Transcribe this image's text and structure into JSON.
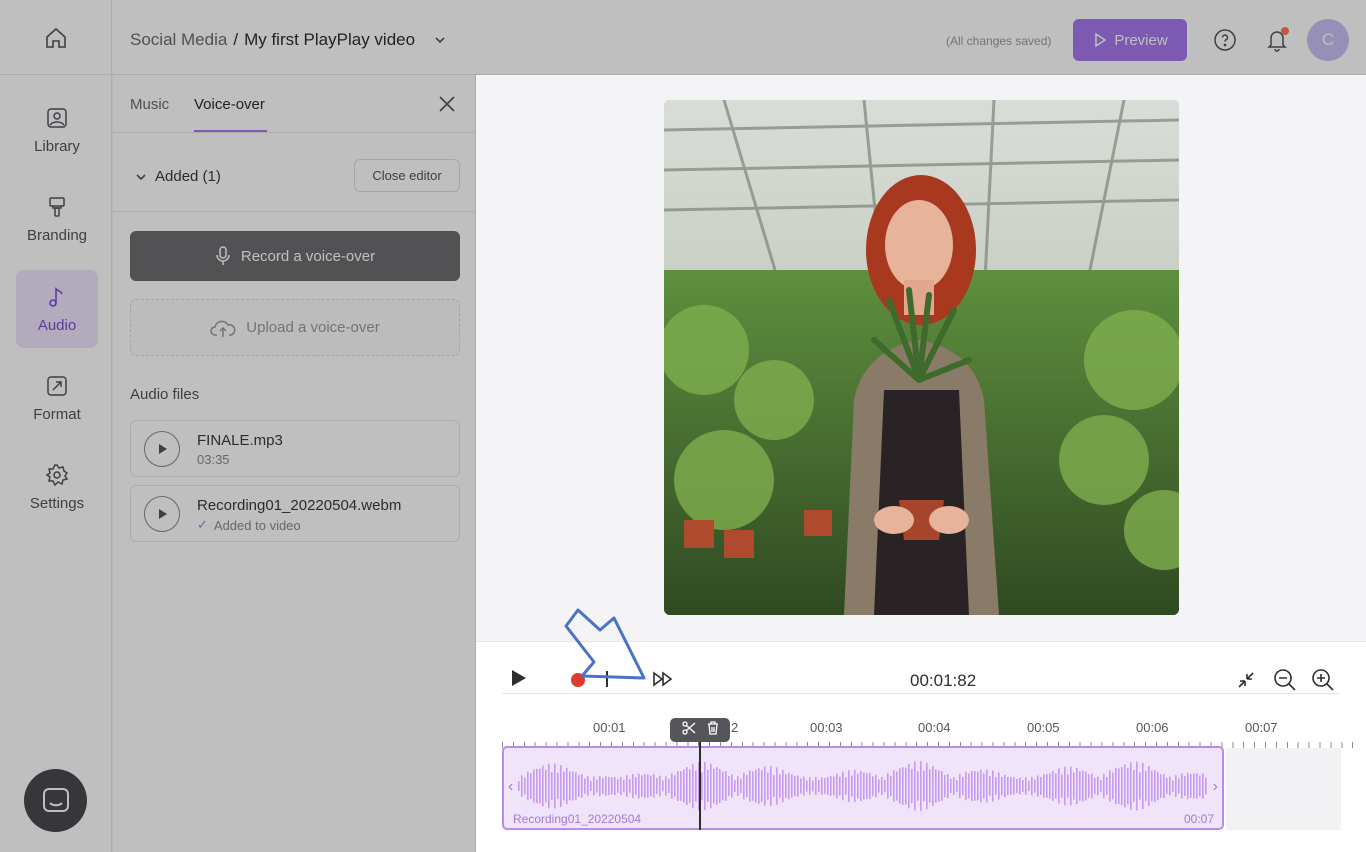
{
  "header": {
    "breadcrumb_parent": "Social Media",
    "breadcrumb_separator": "/",
    "project_title": "My first PlayPlay video",
    "save_status": "(All changes saved)",
    "preview_label": "Preview",
    "avatar_initial": "C"
  },
  "sidebar": {
    "items": [
      {
        "label": "Library",
        "icon": "image-icon"
      },
      {
        "label": "Branding",
        "icon": "paint-roller-icon"
      },
      {
        "label": "Audio",
        "icon": "music-note-icon"
      },
      {
        "label": "Format",
        "icon": "resize-icon"
      },
      {
        "label": "Settings",
        "icon": "gear-icon"
      }
    ],
    "active": "Audio"
  },
  "panel": {
    "tabs": [
      "Music",
      "Voice-over"
    ],
    "active_tab": "Voice-over",
    "added_label": "Added (1)",
    "close_editor_label": "Close editor",
    "record_label": "Record a voice-over",
    "upload_label": "Upload a voice-over",
    "audio_files_title": "Audio files",
    "files": [
      {
        "name": "FINALE.mp3",
        "sub": "03:35"
      },
      {
        "name": "Recording01_20220504.webm",
        "sub": "Added to video"
      }
    ]
  },
  "timeline": {
    "current_time": "00:01:82",
    "ticks": [
      "00:01",
      "2",
      "00:03",
      "00:04",
      "00:05",
      "00:06",
      "00:07"
    ],
    "clip_name": "Recording01_20220504",
    "clip_duration": "00:07"
  },
  "colors": {
    "accent": "#a678ef",
    "record": "#e03a2f",
    "clip_bg": "#f0e4fb"
  }
}
